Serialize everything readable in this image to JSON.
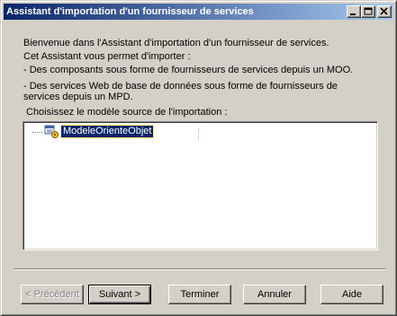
{
  "window": {
    "title": "Assistant d'importation d'un fournisseur de services"
  },
  "intro": {
    "line1": "Bienvenue dans l'Assistant d'importation d'un fournisseur de services.",
    "line2": "Cet Assistant vous permet d'importer :",
    "line3": "- Des composants sous forme de fournisseurs de services depuis un MOO.",
    "line4a": "- Des services Web de base de données sous forme de fournisseurs de",
    "line4b": "services depuis un MPD."
  },
  "choose_label": "Choisissez le modèle source de l'importation :",
  "tree": {
    "items": [
      {
        "label": "ModeleOrienteObjet",
        "icon": "object-model-icon",
        "selected": true
      }
    ]
  },
  "buttons": {
    "previous": "< Précédent",
    "next": "Suivant >",
    "finish": "Terminer",
    "cancel": "Annuler",
    "help": "Aide"
  },
  "colors": {
    "titlebar_start": "#0a246a",
    "titlebar_end": "#a6caf0",
    "selection": "#0a246a",
    "face": "#d4d0c8"
  }
}
